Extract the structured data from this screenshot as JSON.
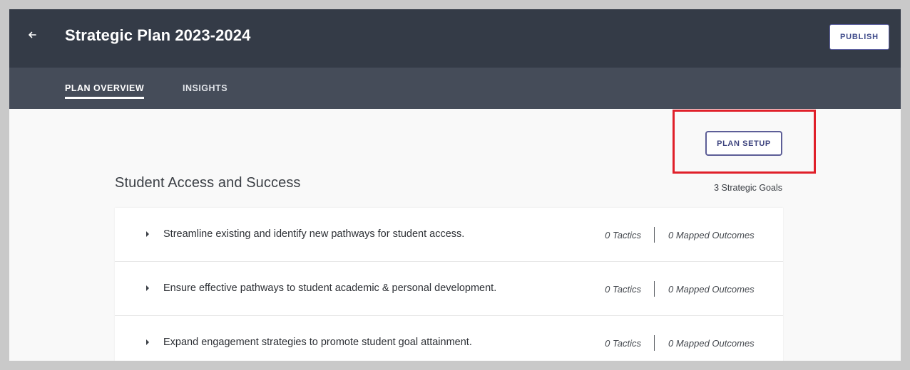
{
  "header": {
    "back_icon": "arrow-left-icon",
    "title": "Strategic Plan 2023-2024",
    "publish_label": "PUBLISH"
  },
  "tabs": [
    {
      "label": "PLAN OVERVIEW",
      "active": true
    },
    {
      "label": "INSIGHTS",
      "active": false
    }
  ],
  "plan_setup_label": "PLAN SETUP",
  "section": {
    "title": "Student Access and Success",
    "goal_count": "3 Strategic Goals"
  },
  "goals": [
    {
      "text": "Streamline existing and identify new pathways for student access.",
      "tactics": "0 Tactics",
      "outcomes": "0 Mapped Outcomes"
    },
    {
      "text": "Ensure effective pathways to student academic & personal development.",
      "tactics": "0 Tactics",
      "outcomes": "0 Mapped Outcomes"
    },
    {
      "text": "Expand engagement strategies to promote student goal attainment.",
      "tactics": "0 Tactics",
      "outcomes": "0 Mapped Outcomes"
    }
  ],
  "colors": {
    "header_bg": "#343b47",
    "tabbar_bg": "#454c59",
    "accent": "#5d5e97",
    "highlight": "#e0202a"
  }
}
